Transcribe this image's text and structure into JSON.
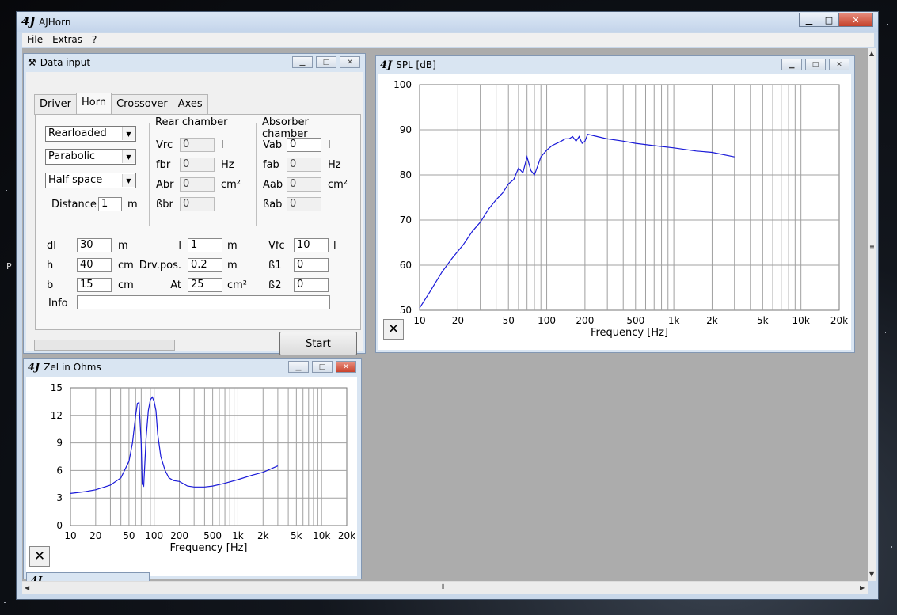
{
  "app": {
    "logo": "4J",
    "title": "AJHorn"
  },
  "menu": [
    "File",
    "Extras",
    "?"
  ],
  "desktop_letter": "P",
  "data_input": {
    "title": "Data input",
    "tabs": [
      "Driver",
      "Horn",
      "Crossover",
      "Axes"
    ],
    "active_tab": "Horn",
    "combos": [
      "Rearloaded",
      "Parabolic",
      "Half space"
    ],
    "distance": {
      "label": "Distance",
      "value": "1",
      "unit": "m"
    },
    "rear_chamber": {
      "title": "Rear chamber",
      "rows": [
        {
          "label": "Vrc",
          "value": "0",
          "unit": "l"
        },
        {
          "label": "fbr",
          "value": "0",
          "unit": "Hz"
        },
        {
          "label": "Abr",
          "value": "0",
          "unit": "cm²"
        },
        {
          "label": "ßbr",
          "value": "0",
          "unit": ""
        }
      ]
    },
    "absorber_chamber": {
      "title": "Absorber chamber",
      "rows": [
        {
          "label": "Vab",
          "value": "0",
          "unit": "l"
        },
        {
          "label": "fab",
          "value": "0",
          "unit": "Hz"
        },
        {
          "label": "Aab",
          "value": "0",
          "unit": "cm²"
        },
        {
          "label": "ßab",
          "value": "0",
          "unit": ""
        }
      ]
    },
    "params": {
      "col1": [
        {
          "label": "dl",
          "value": "30",
          "unit": "m"
        },
        {
          "label": "h",
          "value": "40",
          "unit": "cm"
        },
        {
          "label": "b",
          "value": "15",
          "unit": "cm"
        }
      ],
      "col2": [
        {
          "label": "l",
          "value": "1",
          "unit": "m"
        },
        {
          "label": "Drv.pos.",
          "value": "0.2",
          "unit": "m"
        },
        {
          "label": "At",
          "value": "25",
          "unit": "cm²"
        }
      ],
      "col3": [
        {
          "label": "Vfc",
          "value": "10",
          "unit": "l"
        },
        {
          "label": "ß1",
          "value": "0",
          "unit": ""
        },
        {
          "label": "ß2",
          "value": "0",
          "unit": ""
        }
      ]
    },
    "info_label": "Info",
    "info_value": "",
    "progress": 0,
    "start_button": "Start"
  },
  "spl": {
    "logo": "4J",
    "title": "SPL [dB]",
    "close_glyph": "✕"
  },
  "zel": {
    "logo": "4J",
    "title": "Zel in Ohms",
    "close_glyph": "✕"
  },
  "minimized": {
    "logo": "4J"
  },
  "colors": {
    "curve": "#1a1ad8",
    "grid": "#a0a0a0"
  },
  "chart_data": [
    {
      "type": "line",
      "title": "SPL [dB]",
      "xlabel": "Frequency [Hz]",
      "ylabel": "",
      "x_scale": "log",
      "xlim": [
        10,
        20000
      ],
      "ylim": [
        50,
        100
      ],
      "y_ticks": [
        50,
        60,
        70,
        80,
        90,
        100
      ],
      "x_ticks": [
        {
          "v": 10,
          "l": "10"
        },
        {
          "v": 20,
          "l": "20"
        },
        {
          "v": 50,
          "l": "50"
        },
        {
          "v": 100,
          "l": "100"
        },
        {
          "v": 200,
          "l": "200"
        },
        {
          "v": 500,
          "l": "500"
        },
        {
          "v": 1000,
          "l": "1k"
        },
        {
          "v": 2000,
          "l": "2k"
        },
        {
          "v": 5000,
          "l": "5k"
        },
        {
          "v": 10000,
          "l": "10k"
        },
        {
          "v": 20000,
          "l": "20k"
        }
      ],
      "grid": true,
      "series": [
        {
          "x": [
            10,
            12,
            15,
            18,
            22,
            26,
            30,
            35,
            40,
            45,
            50,
            55,
            60,
            65,
            70,
            75,
            80,
            85,
            90,
            100,
            110,
            120,
            130,
            140,
            150,
            160,
            170,
            180,
            190,
            200,
            210,
            250,
            300,
            400,
            500,
            700,
            1000,
            1500,
            2000,
            3000
          ],
          "y": [
            50.5,
            54,
            58.5,
            61.5,
            64.5,
            67.5,
            69.5,
            72.5,
            74.5,
            76,
            78,
            79,
            81.5,
            80.5,
            84,
            81,
            80,
            82,
            84,
            85.5,
            86.5,
            87,
            87.5,
            88,
            88,
            88.5,
            87.5,
            88.5,
            87,
            87.5,
            89,
            88.5,
            88,
            87.5,
            87,
            86.5,
            86,
            85.3,
            85,
            84
          ]
        }
      ]
    },
    {
      "type": "line",
      "title": "Zel in Ohms",
      "xlabel": "Frequency [Hz]",
      "ylabel": "",
      "x_scale": "log",
      "xlim": [
        10,
        20000
      ],
      "ylim": [
        0,
        15
      ],
      "y_ticks": [
        0,
        3,
        6,
        9,
        12,
        15
      ],
      "x_ticks": [
        {
          "v": 10,
          "l": "10"
        },
        {
          "v": 20,
          "l": "20"
        },
        {
          "v": 50,
          "l": "50"
        },
        {
          "v": 100,
          "l": "100"
        },
        {
          "v": 200,
          "l": "200"
        },
        {
          "v": 500,
          "l": "500"
        },
        {
          "v": 1000,
          "l": "1k"
        },
        {
          "v": 2000,
          "l": "2k"
        },
        {
          "v": 5000,
          "l": "5k"
        },
        {
          "v": 10000,
          "l": "10k"
        },
        {
          "v": 20000,
          "l": "20k"
        }
      ],
      "grid": true,
      "series": [
        {
          "x": [
            10,
            15,
            20,
            30,
            40,
            50,
            55,
            60,
            63,
            66,
            70,
            72,
            75,
            80,
            85,
            90,
            95,
            100,
            105,
            110,
            120,
            135,
            150,
            170,
            200,
            250,
            300,
            400,
            500,
            700,
            1000,
            1500,
            2000,
            3000
          ],
          "y": [
            3.5,
            3.7,
            3.9,
            4.4,
            5.2,
            7,
            9,
            12,
            13.3,
            13.4,
            9,
            4.5,
            4.3,
            9.5,
            12.5,
            13.7,
            14,
            13.5,
            12.5,
            10,
            7.5,
            6,
            5.2,
            4.9,
            4.8,
            4.3,
            4.2,
            4.2,
            4.3,
            4.6,
            5,
            5.5,
            5.8,
            6.5
          ]
        }
      ]
    }
  ]
}
